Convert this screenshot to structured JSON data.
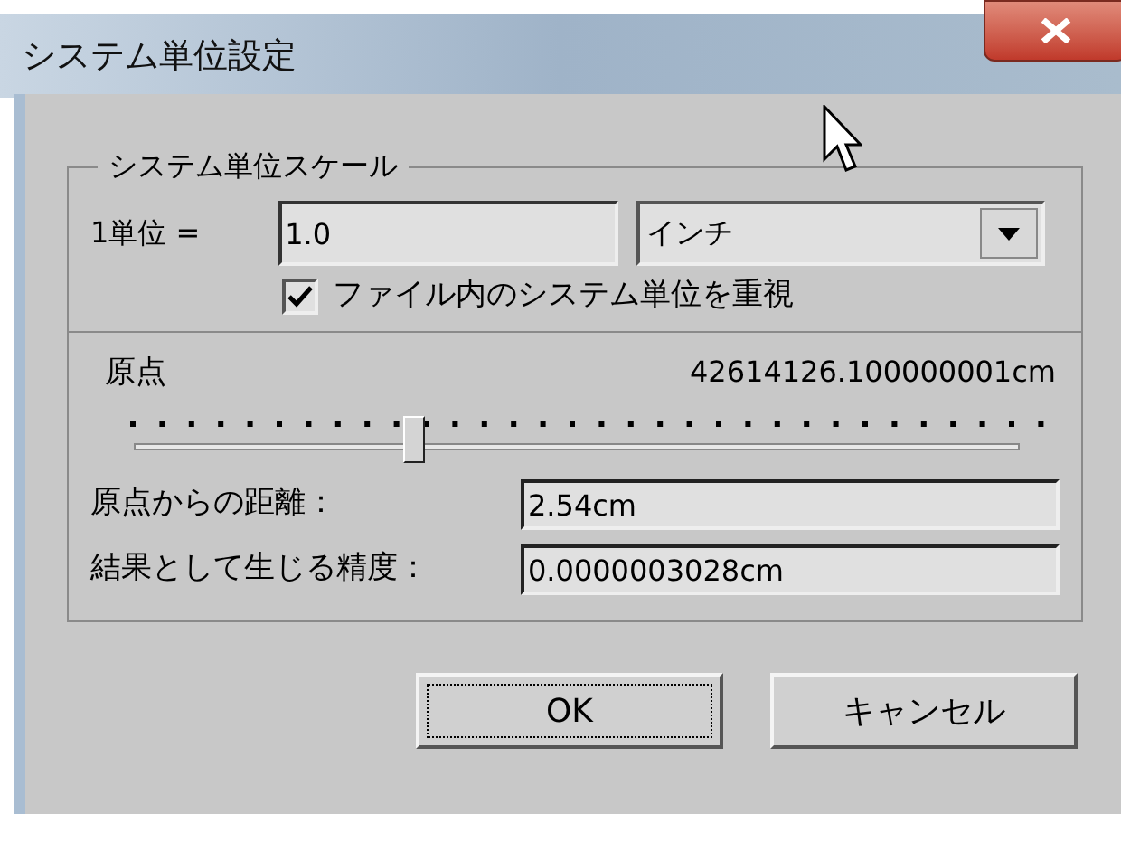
{
  "window": {
    "title": "システム単位設定"
  },
  "scale_group": {
    "title": "システム単位スケール",
    "unit_label": "1単位 =",
    "unit_value": "1.0",
    "unit_select": "インチ",
    "respect_checkbox": {
      "label": "ファイル内のシステム単位を重視",
      "checked": true
    }
  },
  "origin": {
    "label": "原点",
    "reading": "42614126.100000001cm",
    "level": 0.32
  },
  "fields": [
    {
      "label": "原点からの距離：",
      "value": "2.54cm"
    },
    {
      "label": "結果として生じる精度：",
      "value": "0.0000003028cm"
    }
  ],
  "buttons": [
    {
      "label": "OK",
      "focused": true
    },
    {
      "label": "キャンセル",
      "focused": false
    }
  ]
}
